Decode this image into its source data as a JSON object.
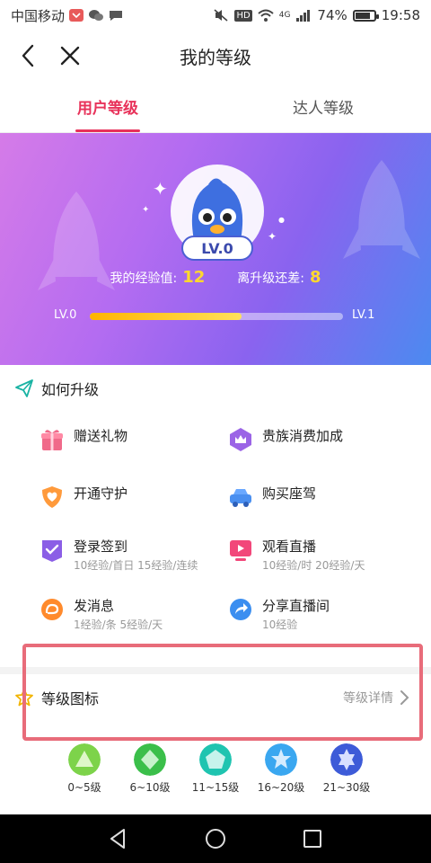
{
  "status_bar": {
    "carrier": "中国移动",
    "battery": "74%",
    "battery_level": 0.74,
    "time": "19:58",
    "network": "4G",
    "hd": "HD"
  },
  "nav": {
    "title": "我的等级"
  },
  "tabs": [
    {
      "label": "用户等级",
      "active": true
    },
    {
      "label": "达人等级",
      "active": false
    }
  ],
  "banner": {
    "level_badge": "LV.0",
    "exp_label": "我的经验值:",
    "exp_value": "12",
    "remaining_label": "离升级还差:",
    "remaining_value": "8",
    "progress_start": "LV.0",
    "progress_end": "LV.1",
    "progress_fraction": 0.6
  },
  "upgrade": {
    "title": "如何升级",
    "items": [
      {
        "title": "赠送礼物",
        "sub": "",
        "icon": "gift-icon"
      },
      {
        "title": "贵族消费加成",
        "sub": "",
        "icon": "crown-icon"
      },
      {
        "title": "开通守护",
        "sub": "",
        "icon": "shield-heart-icon"
      },
      {
        "title": "购买座驾",
        "sub": "",
        "icon": "car-icon"
      },
      {
        "title": "登录签到",
        "sub": "10经验/首日 15经验/连续",
        "icon": "checkin-icon"
      },
      {
        "title": "观看直播",
        "sub": "10经验/时 20经验/天",
        "icon": "play-tv-icon"
      },
      {
        "title": "发消息",
        "sub": "1经验/条 5经验/天",
        "icon": "message-icon"
      },
      {
        "title": "分享直播间",
        "sub": "10经验",
        "icon": "share-icon"
      }
    ]
  },
  "level_section": {
    "title": "等级图标",
    "detail_link": "等级详情",
    "levels": [
      {
        "label": "0~5级",
        "color": "#7dd34a"
      },
      {
        "label": "6~10级",
        "color": "#3bbf4a"
      },
      {
        "label": "11~15级",
        "color": "#1fc4b0"
      },
      {
        "label": "16~20级",
        "color": "#3aa7f0"
      },
      {
        "label": "21~30级",
        "color": "#3d5bd8"
      }
    ]
  },
  "colors": {
    "accent": "#e8325a",
    "exp_highlight": "#ffd82e",
    "highlight_box": "#e86c7a"
  }
}
